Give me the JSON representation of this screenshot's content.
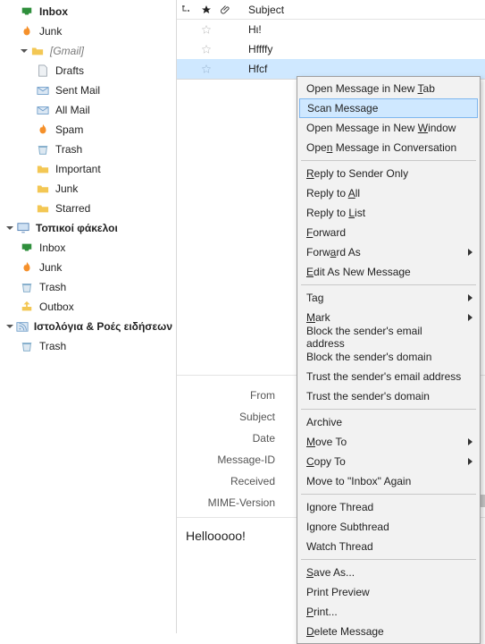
{
  "folders": {
    "account_rows": [
      {
        "label": "Inbox",
        "icon": "inbox-icon",
        "indent": 1,
        "bold": true
      },
      {
        "label": "Junk",
        "icon": "fire-icon",
        "indent": 1
      },
      {
        "label": "[Gmail]",
        "icon": "folder-icon",
        "indent": 1,
        "muted": true,
        "twisty": "down"
      },
      {
        "label": "Drafts",
        "icon": "paper-icon",
        "indent": 2
      },
      {
        "label": "Sent Mail",
        "icon": "mail-icon",
        "indent": 2
      },
      {
        "label": "All Mail",
        "icon": "mail-icon",
        "indent": 2
      },
      {
        "label": "Spam",
        "icon": "fire-icon",
        "indent": 2
      },
      {
        "label": "Trash",
        "icon": "trash-icon",
        "indent": 2
      },
      {
        "label": "Important",
        "icon": "folder-icon",
        "indent": 2
      },
      {
        "label": "Junk",
        "icon": "folder-icon",
        "indent": 2
      },
      {
        "label": "Starred",
        "icon": "folder-icon",
        "indent": 2
      }
    ],
    "local_heading": "Τοπικοί φάκελοι",
    "local_rows": [
      {
        "label": "Inbox",
        "icon": "inbox-icon",
        "indent": 1
      },
      {
        "label": "Junk",
        "icon": "fire-icon",
        "indent": 1
      },
      {
        "label": "Trash",
        "icon": "trash-icon",
        "indent": 1
      },
      {
        "label": "Outbox",
        "icon": "outbox-icon",
        "indent": 1
      }
    ],
    "feeds_heading": "Ιστολόγια & Ροές ειδήσεων",
    "feeds_rows": [
      {
        "label": "Trash",
        "icon": "trash-icon",
        "indent": 1
      }
    ]
  },
  "list": {
    "col_subject": "Subject",
    "rows": [
      {
        "subject": "Hι!",
        "selected": false
      },
      {
        "subject": "Hffffy",
        "selected": false
      },
      {
        "subject": "Hfcf",
        "selected": true
      }
    ]
  },
  "headers": {
    "from": "From",
    "subject": "Subject",
    "date": "Date",
    "message_id": "Message-ID",
    "received": "Received",
    "mime": "MIME-Version"
  },
  "body_text": "Hellooooo!",
  "ctx": {
    "open_tab": "Open Message in New Tab",
    "scan": "Scan Message",
    "open_window": "Open Message in New Window",
    "open_conv": "Open Message in Conversation",
    "reply_sender": "Reply to Sender Only",
    "reply_all": "Reply to All",
    "reply_list": "Reply to List",
    "forward": "Forward",
    "forward_as": "Forward As",
    "edit_new": "Edit As New Message",
    "tag": "Tag",
    "mark": "Mark",
    "block_addr": "Block the sender's email address",
    "block_domain": "Block the sender's domain",
    "trust_addr": "Trust the sender's email address",
    "trust_domain": "Trust the sender's domain",
    "archive": "Archive",
    "move_to": "Move To",
    "copy_to": "Copy To",
    "move_again": "Move to \"Inbox\" Again",
    "ignore_thread": "Ignore Thread",
    "ignore_sub": "Ignore Subthread",
    "watch_thread": "Watch Thread",
    "save_as": "Save As...",
    "print_preview": "Print Preview",
    "print": "Print...",
    "delete": "Delete Message"
  }
}
